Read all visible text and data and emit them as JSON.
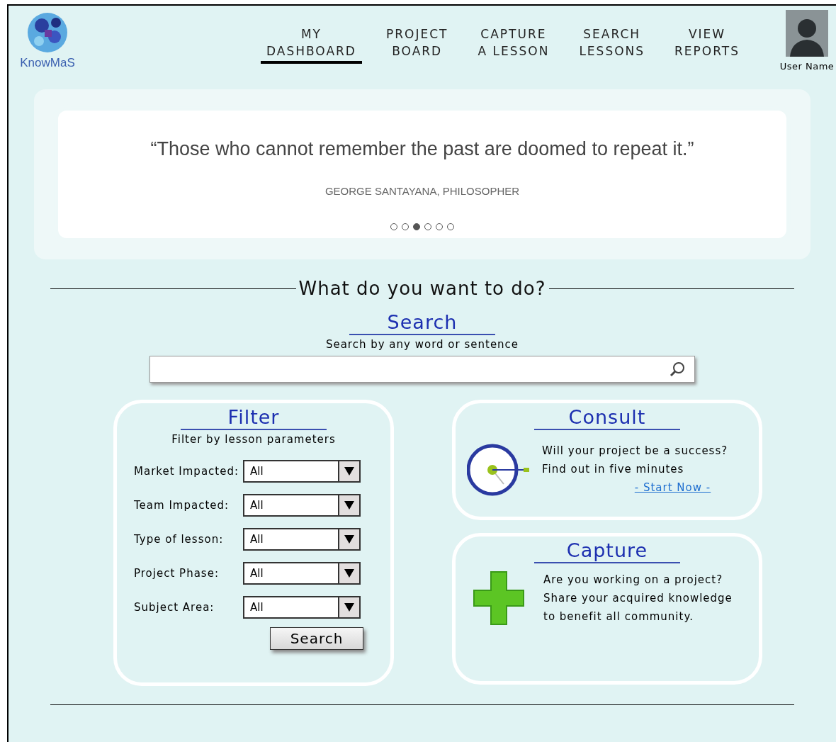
{
  "logo": {
    "name": "KnowMaS"
  },
  "nav": [
    {
      "lines": [
        "MY",
        "DASHBOARD"
      ],
      "selected": true
    },
    {
      "lines": [
        "PROJECT",
        "BOARD"
      ],
      "selected": false
    },
    {
      "lines": [
        "CAPTURE",
        "A LESSON"
      ],
      "selected": false
    },
    {
      "lines": [
        "SEARCH",
        "LESSONS"
      ],
      "selected": false
    },
    {
      "lines": [
        "VIEW",
        "REPORTS"
      ],
      "selected": false
    }
  ],
  "user": {
    "name": "User Name"
  },
  "quote": {
    "text": "“Those who cannot remember the past are doomed to repeat it.”",
    "author": "GEORGE SANTAYANA, PHILOSOPHER",
    "dots": [
      {
        "selected": false
      },
      {
        "selected": false
      },
      {
        "selected": true
      },
      {
        "selected": false
      },
      {
        "selected": false
      },
      {
        "selected": false
      }
    ]
  },
  "heading": "What do you want to do?",
  "search": {
    "title": "Search",
    "subtitle": "Search by any word or sentence"
  },
  "filter": {
    "title": "Filter",
    "subtitle": "Filter by lesson parameters",
    "fields": [
      {
        "label": "Market Impacted:",
        "value": "All"
      },
      {
        "label": "Team Impacted:",
        "value": "All"
      },
      {
        "label": "Type of lesson:",
        "value": "All"
      },
      {
        "label": "Project Phase:",
        "value": "All"
      },
      {
        "label": "Subject Area:",
        "value": "All"
      }
    ],
    "button": "Search"
  },
  "consult": {
    "title": "Consult",
    "lines": [
      "Will your project be a success?",
      "Find out in five minutes"
    ],
    "link": "- Start Now -"
  },
  "capture": {
    "title": "Capture",
    "lines": [
      "Are you working on a project?",
      "Share your acquired knowledge",
      "to benefit all community."
    ]
  }
}
